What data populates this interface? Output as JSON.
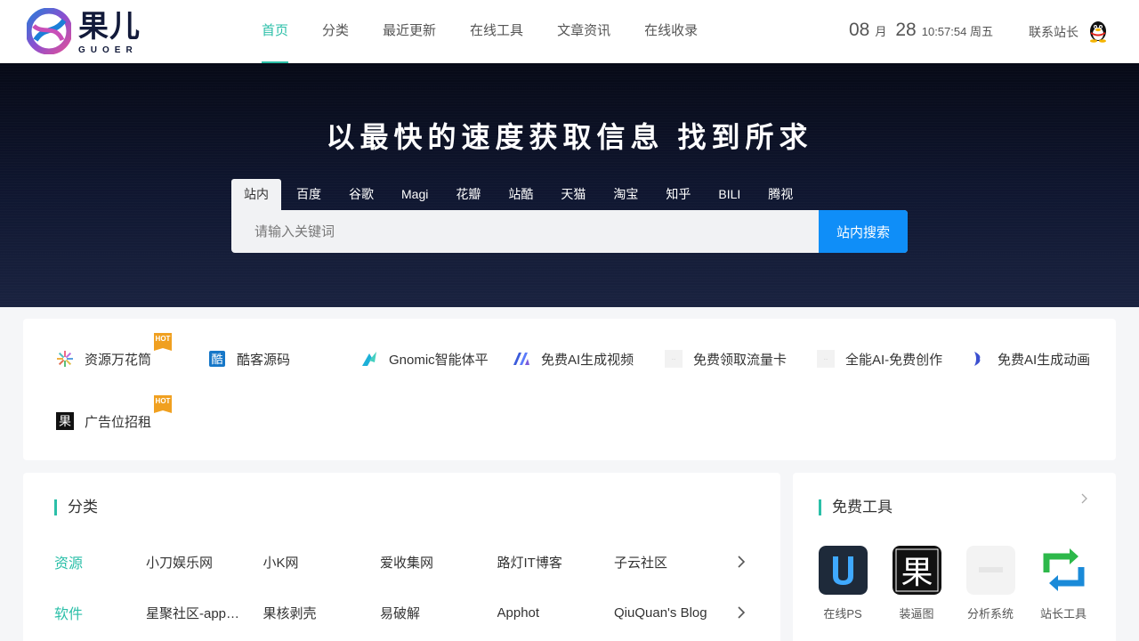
{
  "brand": {
    "name": "果儿",
    "sub": "GUOER"
  },
  "nav": [
    {
      "label": "首页",
      "active": true
    },
    {
      "label": "分类",
      "active": false
    },
    {
      "label": "最近更新",
      "active": false
    },
    {
      "label": "在线工具",
      "active": false
    },
    {
      "label": "文章资讯",
      "active": false
    },
    {
      "label": "在线收录",
      "active": false
    }
  ],
  "date": {
    "month": "08",
    "month_unit": "月",
    "day": "28",
    "time": "10:57:54 周五"
  },
  "contact_label": "联系站长",
  "hero": {
    "title": "以最快的速度获取信息 找到所求",
    "tabs": [
      "站内",
      "百度",
      "谷歌",
      "Magi",
      "花瓣",
      "站酷",
      "天猫",
      "淘宝",
      "知乎",
      "BILI",
      "腾视"
    ],
    "active_tab": "站内",
    "search_placeholder": "请输入关键词",
    "search_button": "站内搜索"
  },
  "quick_links": [
    {
      "label": "资源万花筒",
      "icon": "flower-icon",
      "hot": true
    },
    {
      "label": "酷客源码",
      "icon": "ku-icon",
      "hot": false
    },
    {
      "label": "Gnomic智能体平",
      "icon": "gnomic-icon",
      "hot": false
    },
    {
      "label": "免费AI生成视频",
      "icon": "ai-video-icon",
      "hot": false
    },
    {
      "label": "免费领取流量卡",
      "icon": "placeholder-icon",
      "hot": false
    },
    {
      "label": "全能AI-免费创作",
      "icon": "placeholder-icon",
      "hot": false
    },
    {
      "label": "免费AI生成动画",
      "icon": "ai-anim-icon",
      "hot": false
    },
    {
      "label": "广告位招租",
      "icon": "guo-icon",
      "hot": true
    }
  ],
  "hot_badge": "HOT",
  "categories": {
    "title": "分类",
    "rows": [
      {
        "name": "资源",
        "links": [
          "小刀娱乐网",
          "小K网",
          "爱收集网",
          "路灯IT博客",
          "子云社区"
        ]
      },
      {
        "name": "软件",
        "links": [
          "星聚社区-app…",
          "果核剥壳",
          "易破解",
          "Apphot",
          "QiuQuan's Blog"
        ]
      }
    ]
  },
  "tools": {
    "title": "免费工具",
    "items": [
      {
        "label": "在线PS",
        "icon": "ps-icon"
      },
      {
        "label": "装逼图",
        "icon": "guo-icon"
      },
      {
        "label": "分析系统",
        "icon": "placeholder-icon"
      },
      {
        "label": "站长工具",
        "icon": "refresh-icon"
      }
    ]
  },
  "colors": {
    "accent": "#2bbfa8",
    "search_button": "#0f8ef8",
    "hot": "#f0a020"
  }
}
